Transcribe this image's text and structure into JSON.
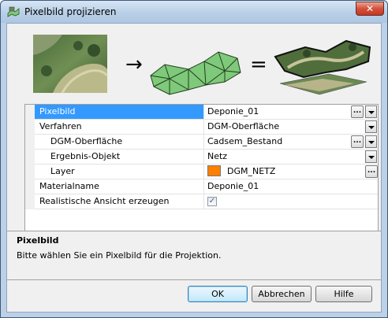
{
  "window": {
    "title": "Pixelbild projizieren",
    "close_label": "✕"
  },
  "illustration": {
    "arrow": "→",
    "equals": "="
  },
  "properties": [
    {
      "label": "Pixelbild",
      "value": "Deponie_01",
      "selected": true,
      "indent": false,
      "browse": true,
      "dropdown": true
    },
    {
      "label": "Verfahren",
      "value": "DGM-Oberfläche",
      "indent": false,
      "dropdown": true
    },
    {
      "label": "DGM-Oberfläche",
      "value": "Cadsem_Bestand",
      "indent": true,
      "browse": true,
      "dropdown": true
    },
    {
      "label": "Ergebnis-Objekt",
      "value": "Netz",
      "indent": true,
      "dropdown": true
    },
    {
      "label": "Layer",
      "value": "DGM_NETZ",
      "indent": true,
      "browse": true,
      "swatch_color": "#ff8000"
    },
    {
      "label": "Materialname",
      "value": "Deponie_01",
      "indent": false
    },
    {
      "label": "Realistische Ansicht erzeugen",
      "value": "",
      "indent": false,
      "checkbox": true,
      "checked": true
    }
  ],
  "browse_label": "...",
  "check_mark": "✓",
  "help": {
    "title": "Pixelbild",
    "text": "Bitte wählen Sie ein Pixelbild für die Projektion."
  },
  "buttons": {
    "ok": "OK",
    "cancel": "Abbrechen",
    "help": "Hilfe"
  },
  "colors": {
    "selection": "#3399ff",
    "mesh_green": "#7fc97a",
    "layer_swatch": "#ff8000"
  }
}
